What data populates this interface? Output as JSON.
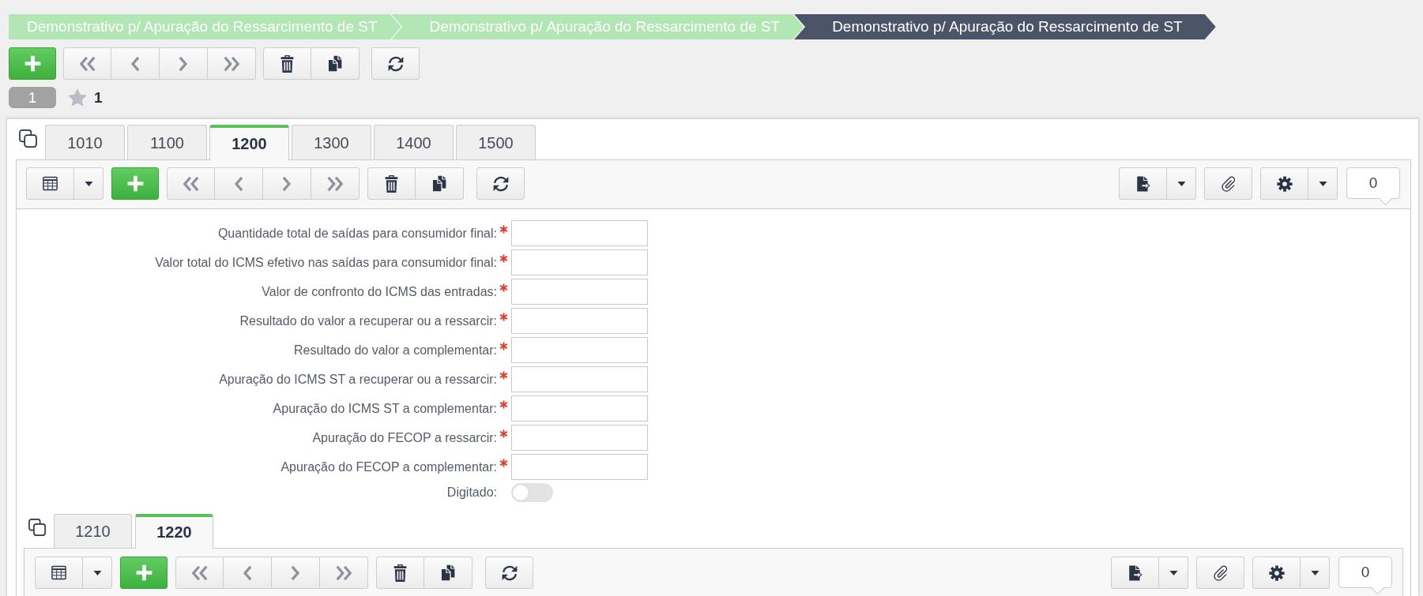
{
  "breadcrumbs": [
    {
      "label": "Demonstrativo p/ Apuração do Ressarcimento de ST",
      "selected": false
    },
    {
      "label": "Demonstrativo p/ Apuração do Ressarcimento de ST",
      "selected": false
    },
    {
      "label": "Demonstrativo p/ Apuração do Ressarcimento de ST",
      "selected": true
    }
  ],
  "toolbar": {
    "groups": [
      [
        {
          "kind": "add",
          "disabled": false
        }
      ],
      [
        {
          "kind": "first",
          "disabled": true
        },
        {
          "kind": "previous",
          "disabled": true
        },
        {
          "kind": "next",
          "disabled": true
        },
        {
          "kind": "last",
          "disabled": true
        }
      ],
      [
        {
          "kind": "delete",
          "disabled": false
        },
        {
          "kind": "duplicate",
          "disabled": false
        }
      ],
      [
        {
          "kind": "refresh",
          "disabled": false
        }
      ]
    ]
  },
  "record_bar": {
    "page": "1",
    "favorites": "1"
  },
  "tabs": [
    {
      "label": "1010",
      "selected": false
    },
    {
      "label": "1100",
      "selected": false
    },
    {
      "label": "1200",
      "selected": true
    },
    {
      "label": "1300",
      "selected": false
    },
    {
      "label": "1400",
      "selected": false
    },
    {
      "label": "1500",
      "selected": false
    }
  ],
  "panel": {
    "toolbar": {
      "left": [
        [
          {
            "kind": "grid",
            "disabled": false
          },
          {
            "kind": "caret",
            "disabled": false
          }
        ],
        [
          {
            "kind": "add",
            "disabled": false
          }
        ],
        [
          {
            "kind": "first",
            "disabled": true
          },
          {
            "kind": "previous",
            "disabled": true
          },
          {
            "kind": "next",
            "disabled": true
          },
          {
            "kind": "last",
            "disabled": true
          }
        ],
        [
          {
            "kind": "delete",
            "disabled": false
          },
          {
            "kind": "duplicate",
            "disabled": false
          }
        ],
        [
          {
            "kind": "refresh",
            "disabled": false
          }
        ]
      ],
      "right": [
        [
          {
            "kind": "export",
            "disabled": false
          },
          {
            "kind": "caret",
            "disabled": false
          }
        ],
        [
          {
            "kind": "attach",
            "disabled": false
          }
        ],
        [
          {
            "kind": "settings",
            "disabled": false
          },
          {
            "kind": "caret",
            "disabled": false
          }
        ]
      ],
      "counter": "0"
    },
    "form": {
      "fields": [
        {
          "label": "Quantidade total de saídas para consumidor final:",
          "kind": "text",
          "required": true
        },
        {
          "label": "Valor total do ICMS efetivo nas saídas para consumidor final:",
          "kind": "text",
          "required": true
        },
        {
          "label": "Valor de confronto do ICMS das entradas:",
          "kind": "text",
          "required": true
        },
        {
          "label": "Resultado do valor a recuperar ou a ressarcir:",
          "kind": "text",
          "required": true
        },
        {
          "label": "Resultado do valor a complementar:",
          "kind": "text",
          "required": true
        },
        {
          "label": "Apuração do ICMS ST a recuperar ou a ressarcir:",
          "kind": "text",
          "required": true
        },
        {
          "label": "Apuração do ICMS ST a complementar:",
          "kind": "text",
          "required": true
        },
        {
          "label": "Apuração do FECOP a ressarcir:",
          "kind": "text",
          "required": true
        },
        {
          "label": "Apuração do FECOP a complementar:",
          "kind": "text",
          "required": true
        },
        {
          "label": "Digitado:",
          "kind": "toggle",
          "required": false,
          "on": false
        }
      ]
    },
    "subtabs": [
      {
        "label": "1210",
        "selected": false
      },
      {
        "label": "1220",
        "selected": true
      }
    ],
    "subpanel": {
      "toolbar": {
        "left": [
          [
            {
              "kind": "grid",
              "disabled": false
            },
            {
              "kind": "caret",
              "disabled": false
            }
          ],
          [
            {
              "kind": "add",
              "disabled": false
            }
          ],
          [
            {
              "kind": "first",
              "disabled": true
            },
            {
              "kind": "previous",
              "disabled": true
            },
            {
              "kind": "next",
              "disabled": true
            },
            {
              "kind": "last",
              "disabled": true
            }
          ],
          [
            {
              "kind": "delete",
              "disabled": false
            },
            {
              "kind": "duplicate",
              "disabled": false
            }
          ],
          [
            {
              "kind": "refresh",
              "disabled": false
            }
          ]
        ],
        "right": [
          [
            {
              "kind": "export",
              "disabled": false
            },
            {
              "kind": "caret",
              "disabled": false
            }
          ],
          [
            {
              "kind": "attach",
              "disabled": false
            }
          ],
          [
            {
              "kind": "settings",
              "disabled": false
            },
            {
              "kind": "caret",
              "disabled": false
            }
          ]
        ],
        "counter": "0"
      }
    }
  }
}
